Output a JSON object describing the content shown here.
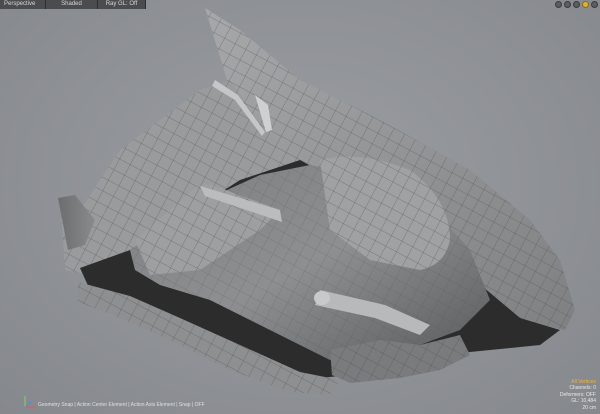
{
  "toolbar": {
    "view_label": "Perspective",
    "shading_label": "Shaded",
    "raygl_label": "Ray GL: Off"
  },
  "status_bar": {
    "text": "Geometry Snap | Action Center Element | Action Axis Element | Snap | OFF"
  },
  "info_panel": {
    "selection_mode": "All Vertices",
    "channels": "Channels: 0",
    "deformers": "Deformers: OFF",
    "gl_count": "GL: 10,484",
    "grid_size": "20 cm"
  },
  "colors": {
    "background": "#8f9297",
    "mesh_light": "#9c9d9f",
    "mesh_mid": "#6f7072",
    "mesh_dark": "#2a2a2b",
    "accent": "#f2b53a"
  }
}
